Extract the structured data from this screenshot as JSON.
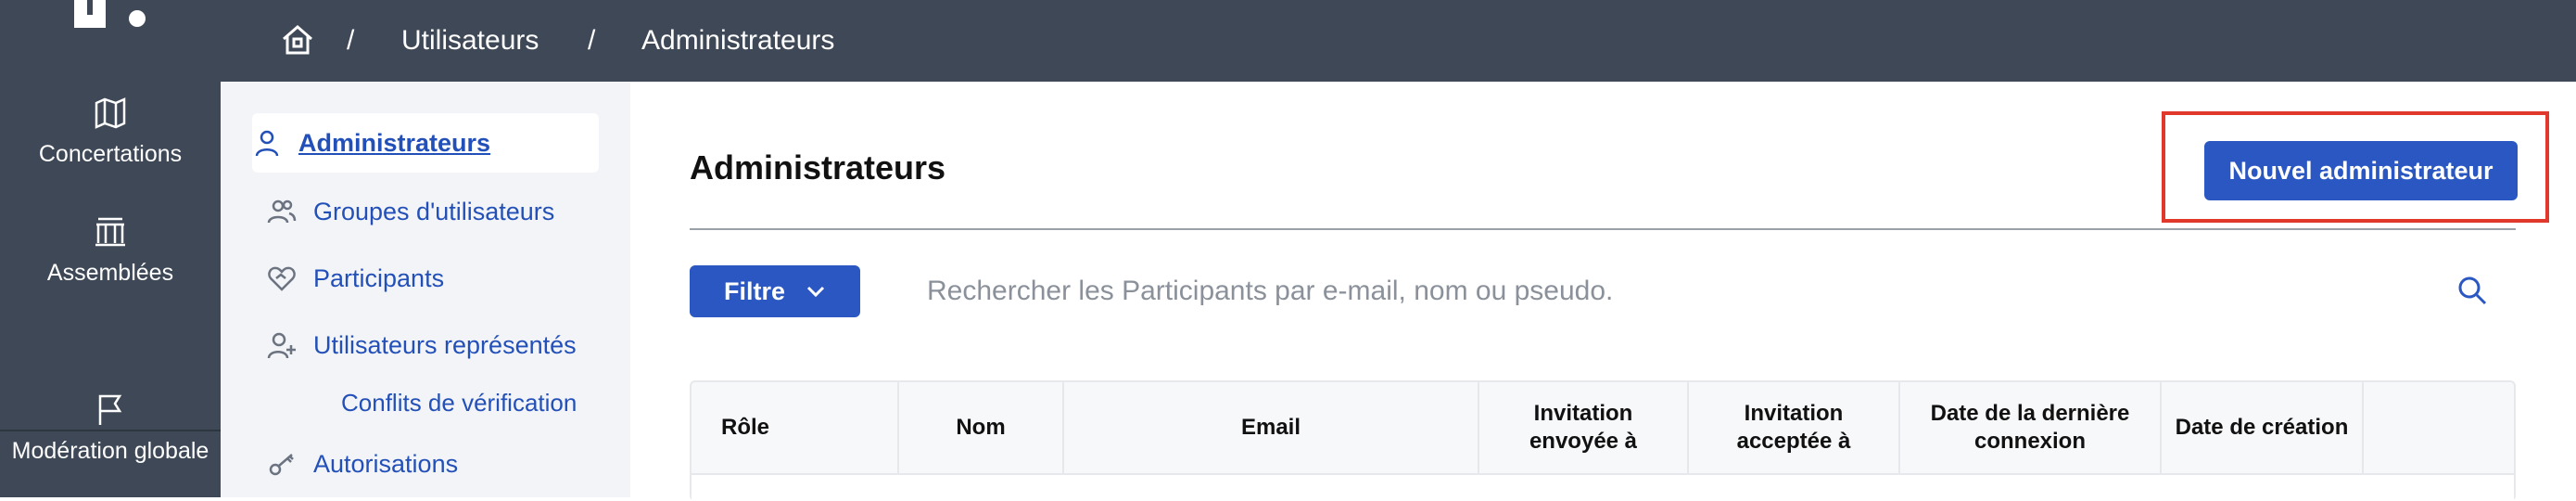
{
  "breadcrumb": {
    "items": [
      "Utilisateurs",
      "Administrateurs"
    ],
    "separator": "/"
  },
  "leftnav": {
    "items": [
      {
        "label": "Concertations",
        "icon": "map-icon"
      },
      {
        "label": "Assemblées",
        "icon": "building-icon"
      },
      {
        "label": "Modération globale",
        "icon": "flag-icon"
      }
    ]
  },
  "subnav": {
    "items": [
      {
        "label": "Administrateurs",
        "icon": "user-icon"
      },
      {
        "label": "Groupes d'utilisateurs",
        "icon": "users-icon"
      },
      {
        "label": "Participants",
        "icon": "heart-handshake-icon"
      },
      {
        "label": "Utilisateurs représentés",
        "icon": "user-plus-icon"
      },
      {
        "label": "Conflits de vérification"
      },
      {
        "label": "Autorisations",
        "icon": "key-icon"
      }
    ]
  },
  "main": {
    "title": "Administrateurs",
    "new_button": "Nouvel administrateur",
    "filter_button": "Filtre",
    "search_placeholder": "Rechercher les Participants par e-mail, nom ou pseudo."
  },
  "table": {
    "headers": [
      "Rôle",
      "Nom",
      "Email",
      "Invitation envoyée à",
      "Invitation acceptée à",
      "Date de la dernière connexion",
      "Date de création",
      ""
    ]
  },
  "colors": {
    "topbar": "#3e4857",
    "accent": "#2a57c2",
    "link": "#2350b8",
    "highlight": "#e0392b"
  }
}
